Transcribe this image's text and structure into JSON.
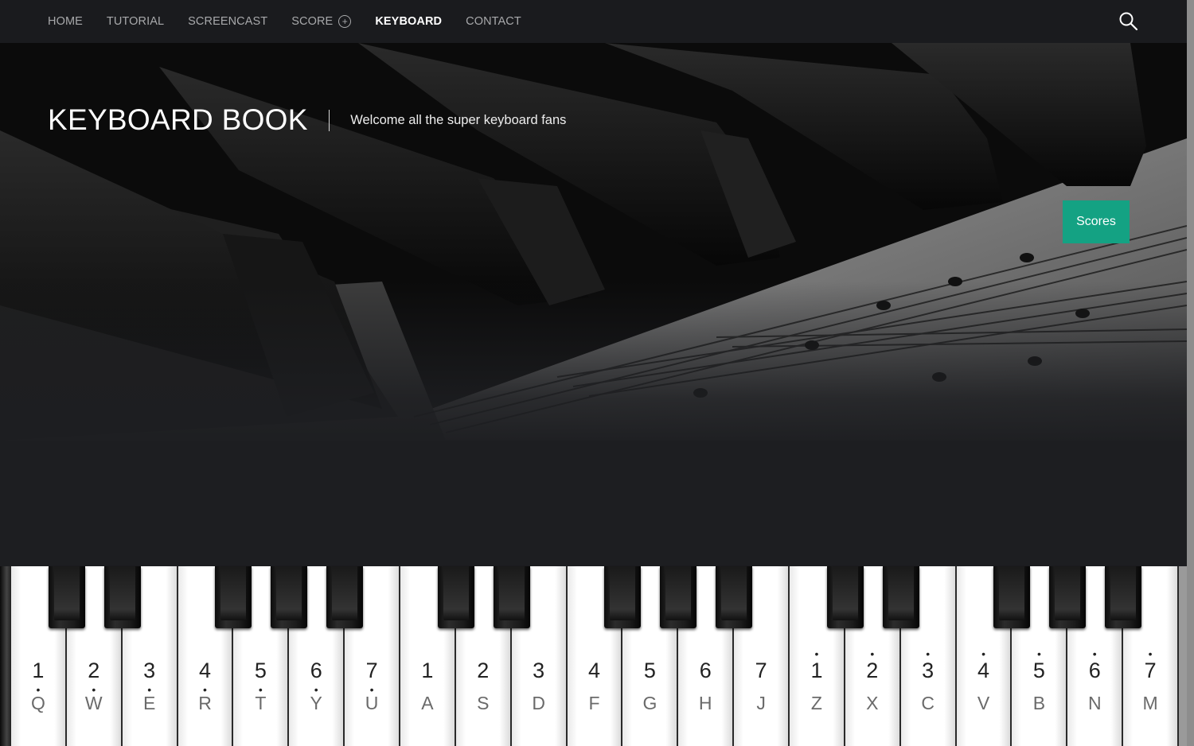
{
  "nav": {
    "items": [
      {
        "label": "HOME",
        "active": false
      },
      {
        "label": "TUTORIAL",
        "active": false
      },
      {
        "label": "SCREENCAST",
        "active": false
      },
      {
        "label": "SCORE",
        "active": false,
        "has_submenu": true
      },
      {
        "label": "KEYBOARD",
        "active": true
      },
      {
        "label": "CONTACT",
        "active": false
      }
    ],
    "search_icon": "search-icon",
    "submenu_icon": "plus-circle-icon"
  },
  "hero": {
    "site_title": "KEYBOARD BOOK",
    "tagline": "Welcome all the super keyboard fans",
    "scores_button": "Scores",
    "background_image": "piano-keys-and-sheet-music-photo"
  },
  "keyboard": {
    "keys": [
      {
        "num": "1",
        "mark": "below",
        "letter": "Q"
      },
      {
        "num": "2",
        "mark": "below",
        "letter": "W"
      },
      {
        "num": "3",
        "mark": "below",
        "letter": "E"
      },
      {
        "num": "4",
        "mark": "below",
        "letter": "R"
      },
      {
        "num": "5",
        "mark": "below",
        "letter": "T"
      },
      {
        "num": "6",
        "mark": "below",
        "letter": "Y"
      },
      {
        "num": "7",
        "mark": "below",
        "letter": "U"
      },
      {
        "num": "1",
        "mark": "none",
        "letter": "A"
      },
      {
        "num": "2",
        "mark": "none",
        "letter": "S"
      },
      {
        "num": "3",
        "mark": "none",
        "letter": "D"
      },
      {
        "num": "4",
        "mark": "none",
        "letter": "F"
      },
      {
        "num": "5",
        "mark": "none",
        "letter": "G"
      },
      {
        "num": "6",
        "mark": "none",
        "letter": "H"
      },
      {
        "num": "7",
        "mark": "none",
        "letter": "J"
      },
      {
        "num": "1",
        "mark": "above",
        "letter": "Z"
      },
      {
        "num": "2",
        "mark": "above",
        "letter": "X"
      },
      {
        "num": "3",
        "mark": "above",
        "letter": "C"
      },
      {
        "num": "4",
        "mark": "above",
        "letter": "V"
      },
      {
        "num": "5",
        "mark": "above",
        "letter": "B"
      },
      {
        "num": "6",
        "mark": "above",
        "letter": "N"
      },
      {
        "num": "7",
        "mark": "above",
        "letter": "M"
      }
    ]
  },
  "colors": {
    "nav_bg": "#1a1b1e",
    "page_bg": "#1d1e21",
    "accent": "#14a283",
    "nav_text": "#a8a9ab",
    "nav_active": "#ffffff"
  }
}
